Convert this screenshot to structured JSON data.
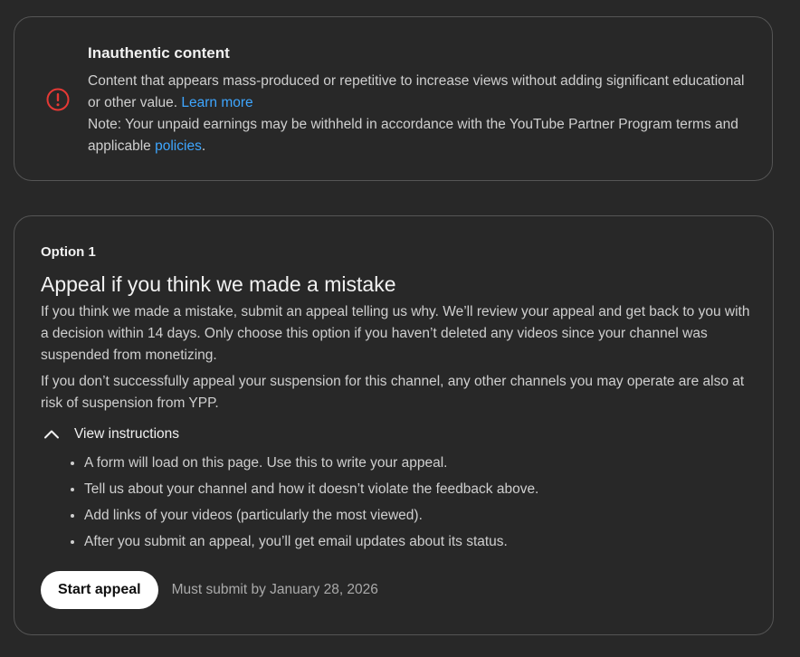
{
  "violation": {
    "title": "Inauthentic content",
    "description": "Content that appears mass-produced or repetitive to increase views without adding significant educational or other value.",
    "learn_more": "Learn more",
    "note_text": "Note: Your unpaid earnings may be withheld in accordance with the YouTube Partner Program terms and applicable",
    "policies_link": "policies",
    "note_end": ".",
    "icon": "alert-circle-icon",
    "icon_color": "#e53935"
  },
  "option": {
    "label": "Option 1",
    "heading": "Appeal if you think we made a mistake",
    "paragraphs": [
      "If you think we made a mistake, submit an appeal telling us why. We’ll review your appeal and get back to you with a decision within 14 days. Only choose this option if you haven’t deleted any videos since your channel was suspended from monetizing.",
      "If you don’t successfully appeal your suspension for this channel, any other channels you may operate are also at risk of suspension from YPP."
    ],
    "instructions_toggle": "View instructions",
    "instructions": [
      "A form will load on this page. Use this to write your appeal.",
      "Tell us about your channel and how it doesn’t violate the feedback above.",
      "Add links of your videos (particularly the most viewed).",
      "After you submit an appeal, you’ll get email updates about its status."
    ],
    "start_button": "Start appeal",
    "deadline": "Must submit by January 28, 2026"
  },
  "colors": {
    "background": "#282828",
    "link": "#3ea6ff",
    "card_border": "#555555"
  }
}
